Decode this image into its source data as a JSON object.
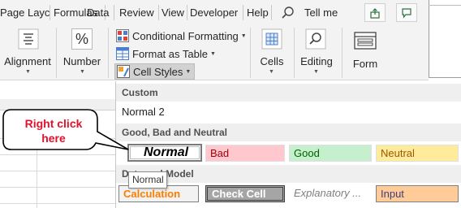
{
  "tabs": [
    {
      "label": "Page Layc"
    },
    {
      "label": "Formulas"
    },
    {
      "label": "Data"
    },
    {
      "label": "Review"
    },
    {
      "label": "View"
    },
    {
      "label": "Developer"
    },
    {
      "label": "Help"
    }
  ],
  "tell_me": {
    "label": "Tell me",
    "icon": "lightbulb-icon"
  },
  "share_icon": "share-icon",
  "comments_icon": "comment-icon",
  "ribbon": {
    "alignment": {
      "label": "Alignment",
      "icon": "align-lines-icon"
    },
    "number": {
      "label": "Number",
      "icon": "percent-icon",
      "glyph": "%"
    },
    "conditional_formatting": {
      "label": "Conditional Formatting",
      "icon": "conditional-formatting-icon"
    },
    "format_as_table": {
      "label": "Format as Table",
      "icon": "format-table-icon"
    },
    "cell_styles": {
      "label": "Cell Styles",
      "icon": "cell-styles-icon"
    },
    "cells": {
      "label": "Cells",
      "icon": "cells-icon"
    },
    "editing": {
      "label": "Editing",
      "icon": "magnifier-icon"
    },
    "form": {
      "label": "Form",
      "icon": "form-icon"
    }
  },
  "panel": {
    "custom_header": "Custom",
    "custom_items": [
      {
        "label": "Normal 2"
      }
    ],
    "good_bad_header": "Good, Bad and Neutral",
    "good_bad_items": [
      {
        "label": "Normal",
        "bg": "#ffffff",
        "fg": "#000000"
      },
      {
        "label": "Bad",
        "bg": "#ffc7ce",
        "fg": "#9c0006"
      },
      {
        "label": "Good",
        "bg": "#c6efce",
        "fg": "#006100"
      },
      {
        "label": "Neutral",
        "bg": "#ffeb9c",
        "fg": "#9c5700"
      }
    ],
    "data_model_header": "Data and Model",
    "data_model_items": [
      {
        "label": "Calculation",
        "bg": "#f2f2f2",
        "fg": "#fa7d00"
      },
      {
        "label": "Check Cell",
        "bg": "#a5a5a5",
        "fg": "#ffffff"
      },
      {
        "label": "Explanatory ...",
        "bg": "#ffffff",
        "fg": "#7f7f7f"
      },
      {
        "label": "Input",
        "bg": "#ffcc99",
        "fg": "#3f3f76"
      }
    ]
  },
  "tooltip": {
    "text": "Normal"
  },
  "callout": {
    "line1": "Right click",
    "line2": "here",
    "color": "#e3122c"
  }
}
